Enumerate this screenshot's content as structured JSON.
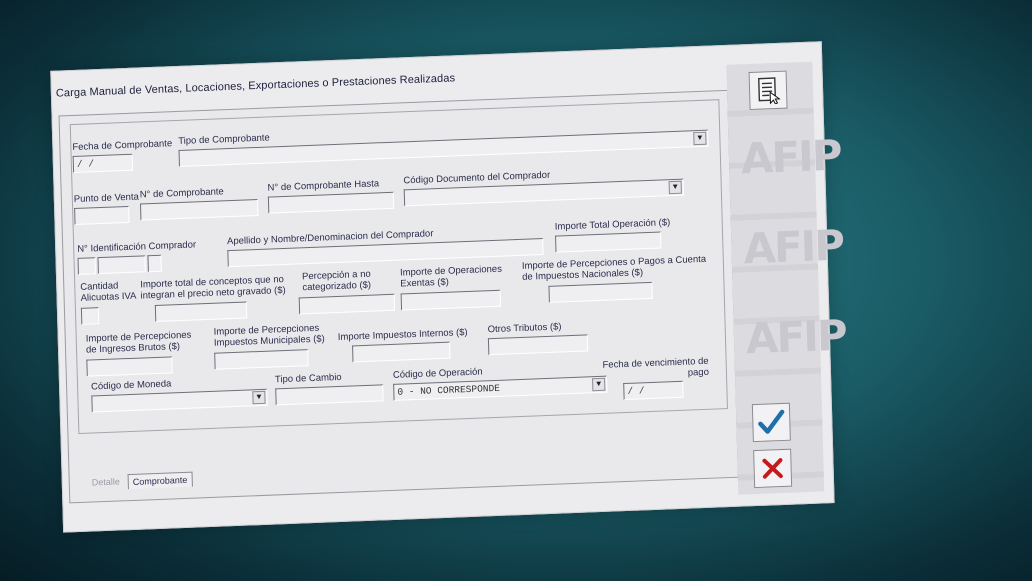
{
  "window": {
    "title": "Carga Manual de Ventas, Locaciones, Exportaciones o Prestaciones Realizadas"
  },
  "form": {
    "fecha_comprobante": {
      "label": "Fecha de Comprobante",
      "value": " /  /"
    },
    "tipo_comprobante": {
      "label": "Tipo de Comprobante",
      "value": ""
    },
    "punto_venta": {
      "label": "Punto de Venta"
    },
    "nro_comprobante": {
      "label": "N° de Comprobante"
    },
    "nro_comprobante_hasta": {
      "label": "N° de Comprobante Hasta"
    },
    "codigo_documento": {
      "label": "Código Documento del Comprador"
    },
    "nro_identificacion": {
      "label": "N° Identificación Comprador"
    },
    "apellido_nombre": {
      "label": "Apellido y Nombre/Denominacion del Comprador"
    },
    "importe_total": {
      "label": "Importe Total Operación ($)"
    },
    "cantidad_alicuotas": {
      "label": "Cantidad Alicuotas IVA"
    },
    "importe_no_integran": {
      "label": "Importe total de conceptos que no integran el precio neto gravado ($)"
    },
    "percepcion_no_categorizado": {
      "label": "Percepción a no categorizado ($)"
    },
    "importe_exentas": {
      "label": "Importe de Operaciones Exentas ($)"
    },
    "percepciones_nacionales": {
      "label": "Importe de Percepciones o Pagos a Cuenta de Impuestos Nacionales ($)"
    },
    "percepciones_iibb": {
      "label": "Importe de Percepciones de Ingresos Brutos ($)"
    },
    "percepciones_municipales": {
      "label": "Importe de Percepciones Impuestos Municipales ($)"
    },
    "impuestos_internos": {
      "label": "Importe Impuestos Internos ($)"
    },
    "otros_tributos": {
      "label": "Otros Tributos ($)"
    },
    "codigo_moneda": {
      "label": "Código de Moneda",
      "value": ""
    },
    "tipo_cambio": {
      "label": "Tipo de Cambio"
    },
    "codigo_operacion": {
      "label": "Código de Operación",
      "value": "0 - NO CORRESPONDE"
    },
    "fecha_vencimiento": {
      "label": "Fecha de vencimiento de pago",
      "value": " /  /"
    }
  },
  "tabs": [
    {
      "label": "Detalle",
      "active": false
    },
    {
      "label": "Comprobante",
      "active": true
    }
  ],
  "sidebar": {
    "watermark": "AFIP",
    "icons": [
      "document-icon",
      "confirm-check-icon",
      "cancel-x-icon"
    ],
    "accent_check": "#1f6fa8",
    "accent_cancel": "#c41a1a"
  }
}
